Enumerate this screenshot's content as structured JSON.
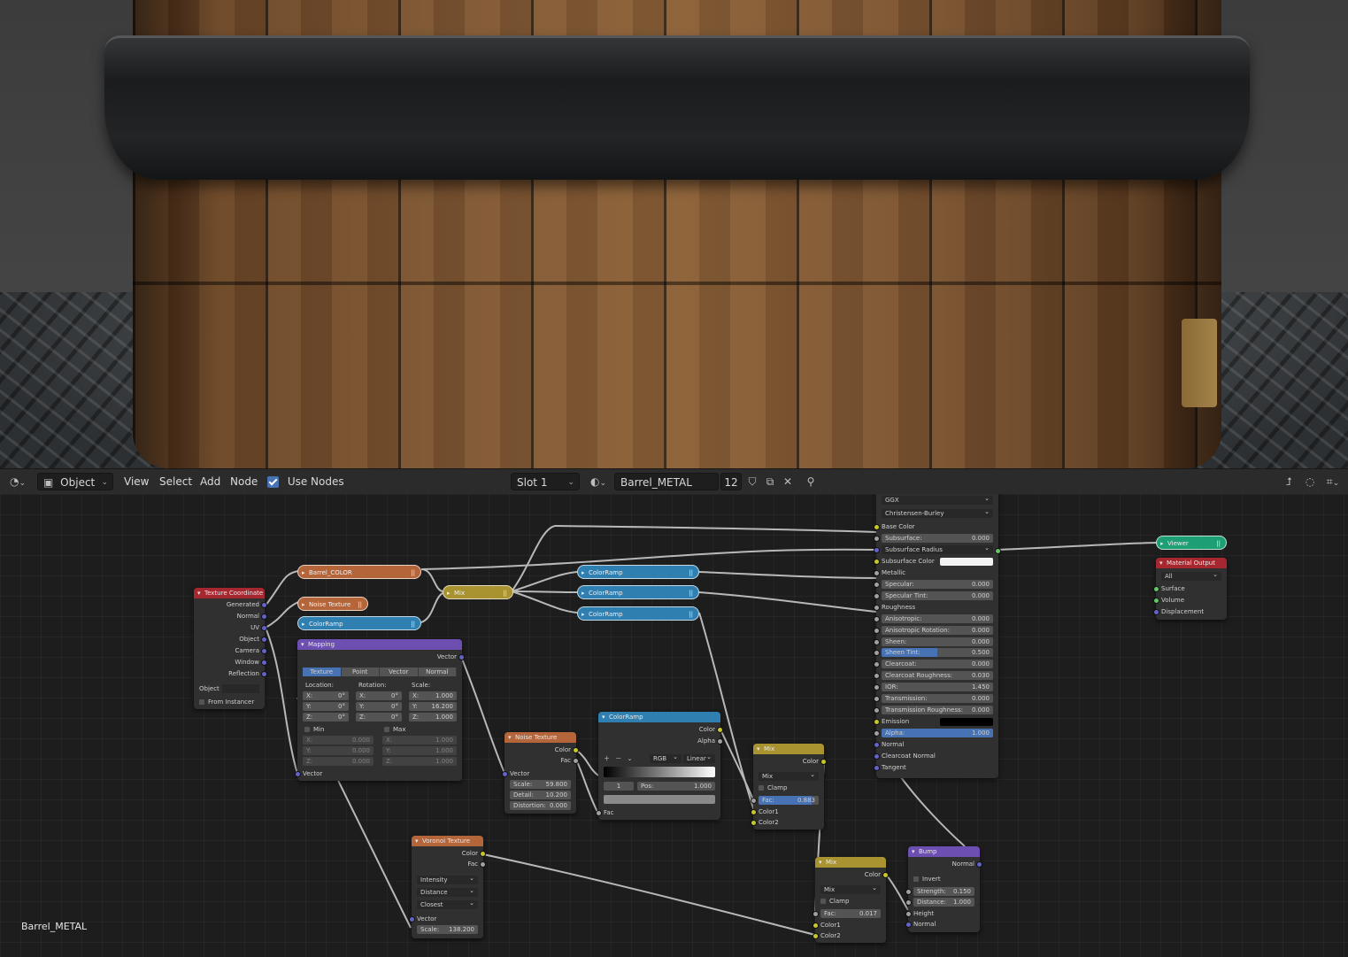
{
  "header": {
    "editor_type_icon": "node-editor-icon",
    "object_mode": "Object",
    "menus": [
      "View",
      "Select",
      "Add",
      "Node"
    ],
    "use_nodes_label": "Use Nodes",
    "slot": "Slot 1",
    "material_name": "Barrel_METAL",
    "user_count": "12"
  },
  "corner_label": "Barrel_METAL",
  "nodes": {
    "barrel_color": "Barrel_COLOR",
    "noise_small": "Noise Texture",
    "colorramp_small": "ColorRamp",
    "mix_top": "Mix",
    "colorramp_a": "ColorRamp",
    "colorramp_b": "ColorRamp",
    "colorramp_c": "ColorRamp",
    "viewer": "Viewer",
    "texcoord": {
      "title": "Texture Coordinate",
      "outputs": [
        "Generated",
        "Normal",
        "UV",
        "Object",
        "Camera",
        "Window",
        "Reflection"
      ],
      "object_label": "Object",
      "from_instancer": "From Instancer"
    },
    "mapping": {
      "title": "Mapping",
      "output": "Vector",
      "tabs": [
        "Texture",
        "Point",
        "Vector",
        "Normal"
      ],
      "location_label": "Location:",
      "rotation_label": "Rotation:",
      "scale_label": "Scale:",
      "loc": [
        "0°",
        "0°",
        "0°"
      ],
      "rot": [
        "0°",
        "0°",
        "0°"
      ],
      "scale": [
        "1.000",
        "16.200",
        "1.000"
      ],
      "axes": [
        "X:",
        "Y:",
        "Z:"
      ],
      "min_label": "Min",
      "max_label": "Max",
      "min": [
        "0.000",
        "0.000",
        "0.000"
      ],
      "max": [
        "1.000",
        "1.000",
        "1.000"
      ],
      "input": "Vector"
    },
    "noise": {
      "title": "Noise Texture",
      "outputs": [
        "Color",
        "Fac"
      ],
      "vector": "Vector",
      "scale_label": "Scale:",
      "scale": "59.800",
      "detail_label": "Detail:",
      "detail": "10.200",
      "distortion_label": "Distortion:",
      "distortion": "0.000"
    },
    "colorramp_big": {
      "title": "ColorRamp",
      "outputs": [
        "Color",
        "Alpha"
      ],
      "mode": "RGB",
      "interp": "Linear",
      "index": "1",
      "pos_label": "Pos:",
      "pos": "1.000",
      "input": "Fac"
    },
    "mix_mid": {
      "title": "Mix",
      "output": "Color",
      "blend": "Mix",
      "clamp": "Clamp",
      "fac_label": "Fac:",
      "fac": "0.883",
      "fac_fraction": 0.883,
      "inputs": [
        "Color1",
        "Color2"
      ]
    },
    "mix_bottom": {
      "title": "Mix",
      "output": "Color",
      "blend": "Mix",
      "clamp": "Clamp",
      "fac_label": "Fac:",
      "fac": "0.017",
      "inputs": [
        "Color1",
        "Color2"
      ]
    },
    "voronoi": {
      "title": "Voronoi Texture",
      "outputs": [
        "Color",
        "Fac"
      ],
      "options": [
        "Intensity",
        "Distance",
        "Closest"
      ],
      "vector": "Vector",
      "scale_label": "Scale:",
      "scale": "138.200"
    },
    "bump": {
      "title": "Bump",
      "output": "Normal",
      "invert": "Invert",
      "strength_label": "Strength:",
      "strength": "0.150",
      "distance_label": "Distance:",
      "distance": "1.000",
      "inputs": [
        "Height",
        "Normal"
      ]
    },
    "material_output": {
      "title": "Material Output",
      "target": "All",
      "inputs": [
        "Surface",
        "Volume",
        "Displacement"
      ]
    },
    "bsdf": {
      "distribution": "GGX",
      "subsurface_method": "Christensen-Burley",
      "rows": [
        {
          "label": "Base Color",
          "kind": "label"
        },
        {
          "label": "Subsurface:",
          "value": "0.000",
          "kind": "field"
        },
        {
          "label": "Subsurface Radius",
          "kind": "select"
        },
        {
          "label": "Subsurface Color",
          "kind": "color",
          "color": "#f2f2f2"
        },
        {
          "label": "Metallic",
          "kind": "label"
        },
        {
          "label": "Specular:",
          "value": "0.000",
          "kind": "field"
        },
        {
          "label": "Specular Tint:",
          "value": "0.000",
          "kind": "field"
        },
        {
          "label": "Roughness",
          "kind": "label"
        },
        {
          "label": "Anisotropic:",
          "value": "0.000",
          "kind": "field"
        },
        {
          "label": "Anisotropic Rotation:",
          "value": "0.000",
          "kind": "field"
        },
        {
          "label": "Sheen:",
          "value": "0.000",
          "kind": "field"
        },
        {
          "label": "Sheen Tint:",
          "value": "0.500",
          "kind": "field",
          "fraction": 0.5
        },
        {
          "label": "Clearcoat:",
          "value": "0.000",
          "kind": "field"
        },
        {
          "label": "Clearcoat Roughness:",
          "value": "0.030",
          "kind": "field"
        },
        {
          "label": "IOR:",
          "value": "1.450",
          "kind": "field"
        },
        {
          "label": "Transmission:",
          "value": "0.000",
          "kind": "field"
        },
        {
          "label": "Transmission Roughness:",
          "value": "0.000",
          "kind": "field"
        },
        {
          "label": "Emission",
          "kind": "color",
          "color": "#000000"
        },
        {
          "label": "Alpha:",
          "value": "1.000",
          "kind": "field",
          "fraction": 1.0
        },
        {
          "label": "Normal",
          "kind": "label"
        },
        {
          "label": "Clearcoat Normal",
          "kind": "label"
        },
        {
          "label": "Tangent",
          "kind": "label"
        }
      ]
    }
  }
}
